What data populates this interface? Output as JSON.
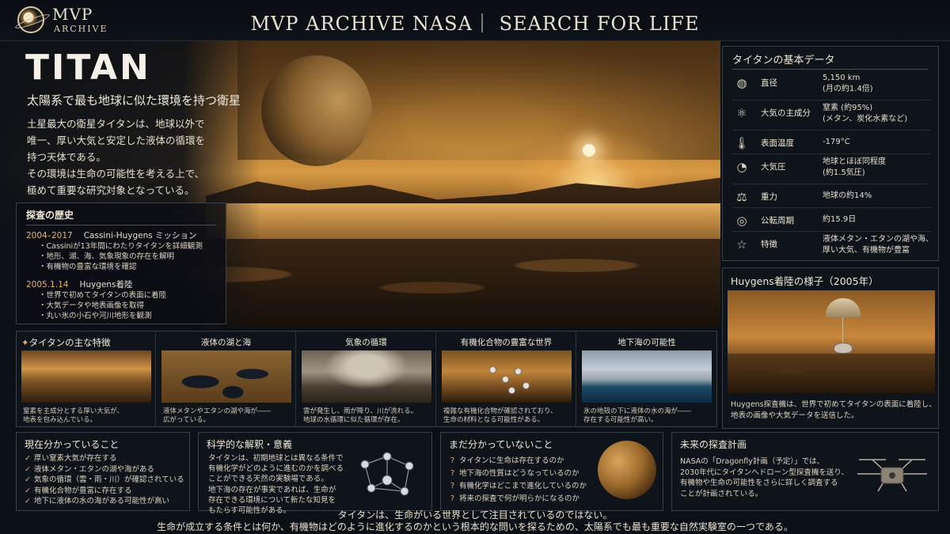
{
  "header": {
    "logo_title": "MVP",
    "logo_sub": "ARCHIVE",
    "title": "MVP ARCHIVE NASA｜ SEARCH FOR LIFE"
  },
  "hero": {
    "name": "TITAN",
    "tagline": "太陽系で最も地球に似た環境を持つ衛星",
    "intro": [
      "土星最大の衛星タイタンは、地球以外で",
      "唯一、厚い大気と安定した液体の循環を",
      "持つ天体である。",
      "その環境は生命の可能性を考える上で、",
      "極めて重要な研究対象となっている。"
    ]
  },
  "history": {
    "title": "探査の歴史",
    "entries": [
      {
        "date": "2004–2017",
        "name": "Cassini-Huygens ミッション",
        "items": [
          "・Cassiniが13年間にわたりタイタンを詳細観測",
          "・地形、湖、海、気象現象の存在を解明",
          "・有機物の豊富な環境を確認"
        ]
      },
      {
        "date": "2005.1.14",
        "name": "Huygens着陸",
        "items": [
          "・世界で初めてタイタンの表面に着陸",
          "・大気データや地表画像を取得",
          "・丸い氷の小石や河川地形を観測"
        ]
      }
    ]
  },
  "basic_data": {
    "title": "タイタンの基本データ",
    "rows": [
      {
        "icon": "globe-icon",
        "glyph": "◍",
        "label": "直径",
        "value": [
          "5,150 km",
          "(月の約1.4倍)"
        ]
      },
      {
        "icon": "molecule-icon",
        "glyph": "⚛",
        "label": "大気の主成分",
        "value": [
          "窒素 (約95%)",
          "(メタン、炭化水素など)"
        ]
      },
      {
        "icon": "thermometer-icon",
        "glyph": "🌡",
        "label": "表面温度",
        "value": [
          "-179°C"
        ]
      },
      {
        "icon": "gauge-icon",
        "glyph": "◔",
        "label": "大気圧",
        "value": [
          "地球とほぼ同程度",
          "(約1.5気圧)"
        ]
      },
      {
        "icon": "gravity-icon",
        "glyph": "⚖",
        "label": "重力",
        "value": [
          "地球の約14%"
        ]
      },
      {
        "icon": "orbit-icon",
        "glyph": "◎",
        "label": "公転周期",
        "value": [
          "約15.9日"
        ]
      },
      {
        "icon": "star-icon",
        "glyph": "☆",
        "label": "特徴",
        "value": [
          "液体メタン・エタンの湖や海、",
          "厚い大気、有機物が豊富"
        ]
      }
    ]
  },
  "huygens": {
    "title": "Huygens着陸の様子（2005年）",
    "caption": [
      "Huygens探査機は、世界で初めてタイタンの表面に着陸し、",
      "地表の画像や大気データを送信した。"
    ]
  },
  "features": {
    "title": "タイタンの主な特徴",
    "cards": [
      {
        "title": "",
        "caption": [
          "窒素を主成分とする厚い大気が、",
          "地表を包み込んでいる。"
        ]
      },
      {
        "title": "液体の湖と海",
        "caption": [
          "液体メタンやエタンの湖や海が――",
          "広がっている。"
        ]
      },
      {
        "title": "気象の循環",
        "caption": [
          "雲が発生し、雨が降り、川が流れる。",
          "地球の水循環に似た循環が存在。"
        ]
      },
      {
        "title": "有機化合物の豊富な世界",
        "caption": [
          "複雑な有機化合物が確認されており、",
          "生命の材料となる可能性がある。"
        ]
      },
      {
        "title": "地下海の可能性",
        "caption": [
          "氷の地殻の下に液体の水の海が――",
          "存在する可能性が高い。"
        ]
      }
    ]
  },
  "known": {
    "title": "現在分かっていること",
    "items": [
      "厚い窒素大気が存在する",
      "液体メタン・エタンの湖や海がある",
      "気象の循環（雲・雨・川）が確認されている",
      "有機化合物が豊富に存在する",
      "地下に液体の水の海がある可能性が高い"
    ]
  },
  "science": {
    "title": "科学的な解釈・意義",
    "lines": [
      "タイタンは、初期地球とは異なる条件で",
      "有機化学がどのように進むのかを調べる",
      "ことができる天然の実験場である。",
      "地下海の存在が事実であれば、生命が",
      "存在できる環境について新たな知見を",
      "もたらす可能性がある。"
    ]
  },
  "unknown": {
    "title": "まだ分かっていないこと",
    "items": [
      "タイタンに生命は存在するのか",
      "地下海の性質はどうなっているのか",
      "有機化学はどこまで進化しているのか",
      "将来の探査で何が明らかになるのか"
    ]
  },
  "future": {
    "title": "未来の探査計画",
    "lines": [
      "NASAの「Dragonfly計画（予定）」では、",
      "2030年代にタイタンへドローン型探査機を送り、",
      "有機物や生命の可能性をさらに詳しく調査する",
      "ことが計画されている。"
    ]
  },
  "footer": [
    "タイタンは、生命がいる世界として注目されているのではない。",
    "生命が成立する条件とは何か、有機物はどのように進化するのかという根本的な問いを探るための、太陽系でも最も重要な自然実験室の一つである。"
  ],
  "colors": {
    "accent": "#e0b472",
    "panel": "#0f131a",
    "border": "#3d4048",
    "text": "#e8e1d2"
  }
}
